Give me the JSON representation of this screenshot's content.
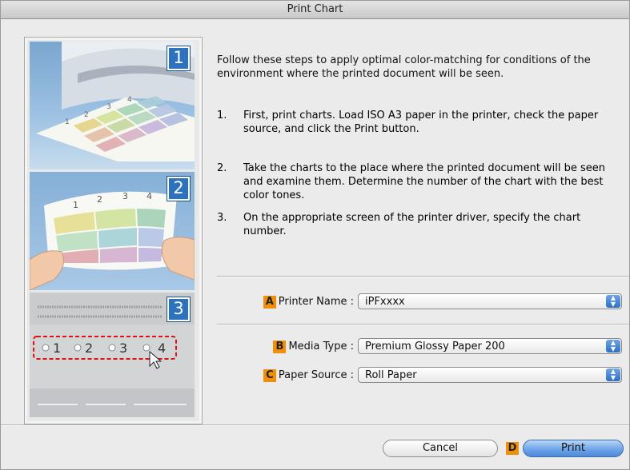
{
  "window": {
    "title": "Print Chart"
  },
  "illustration": {
    "panels": [
      {
        "number": "1",
        "chart_labels": [
          "1",
          "2",
          "3",
          "4"
        ]
      },
      {
        "number": "2",
        "chart_labels": [
          "1",
          "2",
          "3",
          "4"
        ]
      },
      {
        "number": "3",
        "chart_labels": [
          "1",
          "2",
          "3",
          "4"
        ]
      }
    ]
  },
  "instructions": {
    "intro": "Follow these steps to apply optimal color-matching for conditions of the environment where the printed document will be seen.",
    "steps": [
      {
        "num": "1.",
        "text": "First, print charts. Load ISO A3 paper in the printer, check the paper source, and click the Print button."
      },
      {
        "num": "2.",
        "text": "Take the charts to the place where the printed document will be seen and examine them. Determine the number of the chart with the best color tones."
      },
      {
        "num": "3.",
        "text": "On the appropriate screen of the printer driver, specify the chart number."
      }
    ]
  },
  "form": {
    "printer_name": {
      "badge": "A",
      "label": "Printer Name :",
      "value": "iPFxxxx"
    },
    "media_type": {
      "badge": "B",
      "label": "Media Type :",
      "value": "Premium Glossy Paper 200"
    },
    "paper_source": {
      "badge": "C",
      "label": "Paper Source :",
      "value": "Roll Paper"
    }
  },
  "buttons": {
    "cancel": "Cancel",
    "print_badge": "D",
    "print": "Print"
  },
  "colors": {
    "badge": "#f0900a",
    "accent_blue": "#2c72bd"
  }
}
